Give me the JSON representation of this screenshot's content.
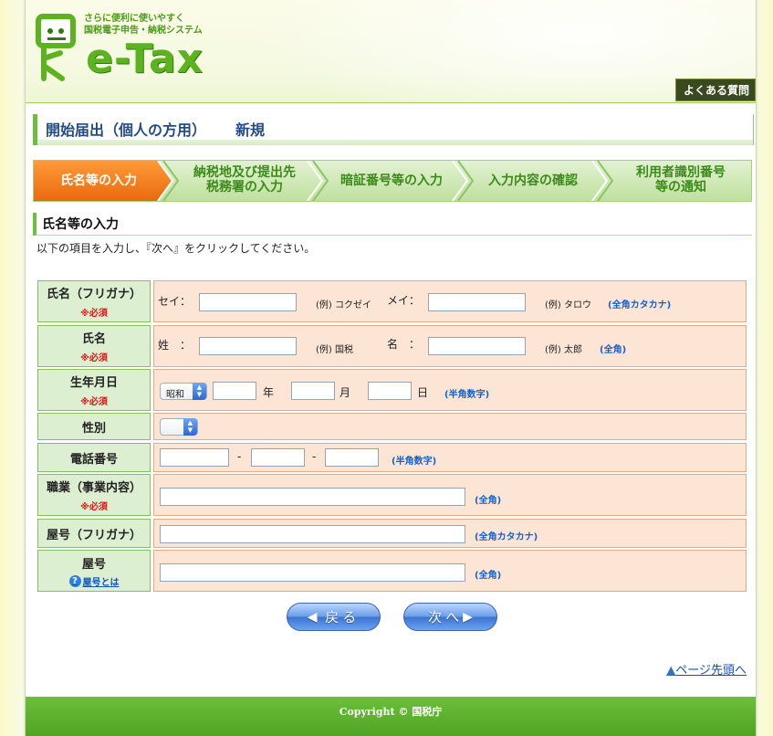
{
  "header": {
    "tagline_line1": "さらに便利に使いやすく",
    "tagline_line2": "国税電子申告・納税システム",
    "logo_text": "e-Tax",
    "faq_label": "よくある質問"
  },
  "page_title": {
    "main": "開始届出（個人の方用）",
    "sub": "新規"
  },
  "steps": [
    {
      "line1": "氏名等の入力",
      "line2": "",
      "active": true
    },
    {
      "line1": "納税地及び提出先",
      "line2": "税務署の入力",
      "active": false
    },
    {
      "line1": "暗証番号等の入力",
      "line2": "",
      "active": false
    },
    {
      "line1": "入力内容の確認",
      "line2": "",
      "active": false
    },
    {
      "line1": "利用者識別番号",
      "line2": "等の通知",
      "active": false
    }
  ],
  "section": {
    "title": "氏名等の入力",
    "instruction": "以下の項目を入力し、『次へ』をクリックしてください。"
  },
  "form": {
    "required_mark": "※必須",
    "furigana": {
      "label": "氏名（フリガナ）",
      "sei_label": "セイ：",
      "sei_example": "(例) コクゼイ",
      "mei_label": "メイ：",
      "mei_example": "(例) タロウ",
      "note": "(全角カタカナ)"
    },
    "name": {
      "label": "氏名",
      "sei_label": "姓　：",
      "sei_example": "(例) 国税",
      "mei_label": "名　：",
      "mei_example": "(例) 太郎",
      "note": "(全角)"
    },
    "birth": {
      "label": "生年月日",
      "era_value": "昭和",
      "year_unit": "年",
      "month_unit": "月",
      "day_unit": "日",
      "note": "(半角数字)"
    },
    "gender": {
      "label": "性別",
      "value": ""
    },
    "phone": {
      "label": "電話番号",
      "sep": "-",
      "note": "(半角数字)"
    },
    "occupation": {
      "label": "職業（事業内容）",
      "note": "(全角)"
    },
    "shop_kana": {
      "label": "屋号（フリガナ）",
      "note": "(全角カタカナ)"
    },
    "shop": {
      "label": "屋号",
      "help_text": "屋号とは",
      "note": "(全角)"
    }
  },
  "buttons": {
    "back": "戻る",
    "next": "次へ"
  },
  "page_top_link": "ページ先頭へ",
  "footer": {
    "copyright": "Copyright © 国税庁"
  },
  "colors": {
    "brand_green": "#5db31f",
    "active_step": "#f07d1e",
    "required": "#e21515",
    "note_blue": "#1560c8"
  }
}
